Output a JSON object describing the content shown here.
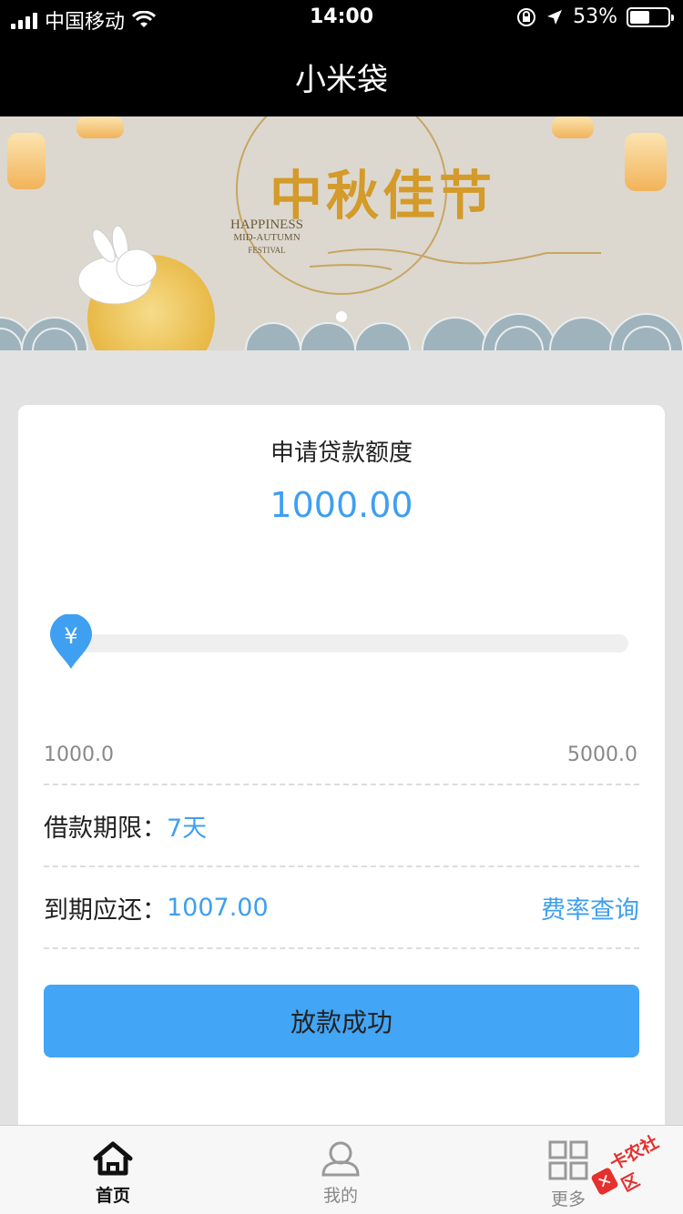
{
  "status_bar": {
    "carrier": "中国移动",
    "time": "14:00",
    "battery": "53%",
    "battery_level": 0.53
  },
  "nav": {
    "title": "小米袋"
  },
  "banner": {
    "headline": "中秋佳节",
    "sub_lines": [
      "HAPPINESS",
      "MID-AUTUMN",
      "FESTIVAL"
    ]
  },
  "loan": {
    "title": "申请贷款额度",
    "amount": "1000.00",
    "range_min": "1000.0",
    "range_max": "5000.0",
    "slider_currency": "¥",
    "term_label": "借款期限：",
    "term_value": "7天",
    "due_label": "到期应还：",
    "due_value": "1007.00",
    "rate_link": "费率查询",
    "submit_label": "放款成功"
  },
  "tabs": [
    {
      "label": "首页",
      "icon": "home-icon",
      "active": true
    },
    {
      "label": "我的",
      "icon": "user-icon",
      "active": false
    },
    {
      "label": "更多",
      "icon": "grid-icon",
      "active": false
    }
  ],
  "watermark": {
    "text": "卡农社区"
  },
  "colors": {
    "accent": "#3f9ff0",
    "button": "#42a5f5"
  }
}
